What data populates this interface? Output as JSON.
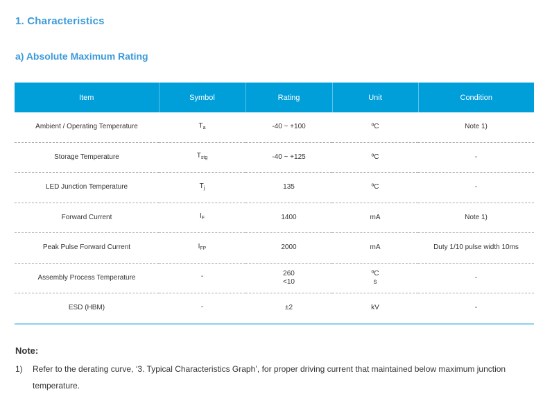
{
  "section_title": "1.  Characteristics",
  "subsection_title": "a)  Absolute Maximum Rating",
  "table": {
    "headers": [
      "Item",
      "Symbol",
      "Rating",
      "Unit",
      "Condition"
    ],
    "rows": [
      {
        "item": "Ambient / Operating Temperature",
        "symbol": "T",
        "symbol_sub": "a",
        "rating": "-40 ~ +100",
        "rating2": "",
        "unit": "ºC",
        "unit2": "",
        "condition": "Note 1)"
      },
      {
        "item": "Storage Temperature",
        "symbol": "T",
        "symbol_sub": "stg",
        "rating": "-40 ~ +125",
        "rating2": "",
        "unit": "ºC",
        "unit2": "",
        "condition": "-"
      },
      {
        "item": "LED Junction Temperature",
        "symbol": "T",
        "symbol_sub": "j",
        "rating": "135",
        "rating2": "",
        "unit": "ºC",
        "unit2": "",
        "condition": "-"
      },
      {
        "item": "Forward Current",
        "symbol": "I",
        "symbol_sub": "F",
        "rating": "1400",
        "rating2": "",
        "unit": "mA",
        "unit2": "",
        "condition": "Note 1)"
      },
      {
        "item": "Peak Pulse Forward Current",
        "symbol": "I",
        "symbol_sub": "FP",
        "rating": "2000",
        "rating2": "",
        "unit": "mA",
        "unit2": "",
        "condition": "Duty 1/10 pulse width 10ms"
      },
      {
        "item": "Assembly Process Temperature",
        "symbol": "-",
        "symbol_sub": "",
        "rating": "260",
        "rating2": "<10",
        "unit": "ºC",
        "unit2": "s",
        "condition": "-"
      },
      {
        "item": "ESD (HBM)",
        "symbol": "-",
        "symbol_sub": "",
        "rating": "±2",
        "rating2": "",
        "unit": "kV",
        "unit2": "",
        "condition": "-"
      }
    ]
  },
  "note": {
    "title": "Note:",
    "items": [
      {
        "num": "1)",
        "text": "Refer to the derating curve, ‘3. Typical Characteristics Graph’, for proper driving current that maintained below maximum junction temperature."
      }
    ]
  }
}
